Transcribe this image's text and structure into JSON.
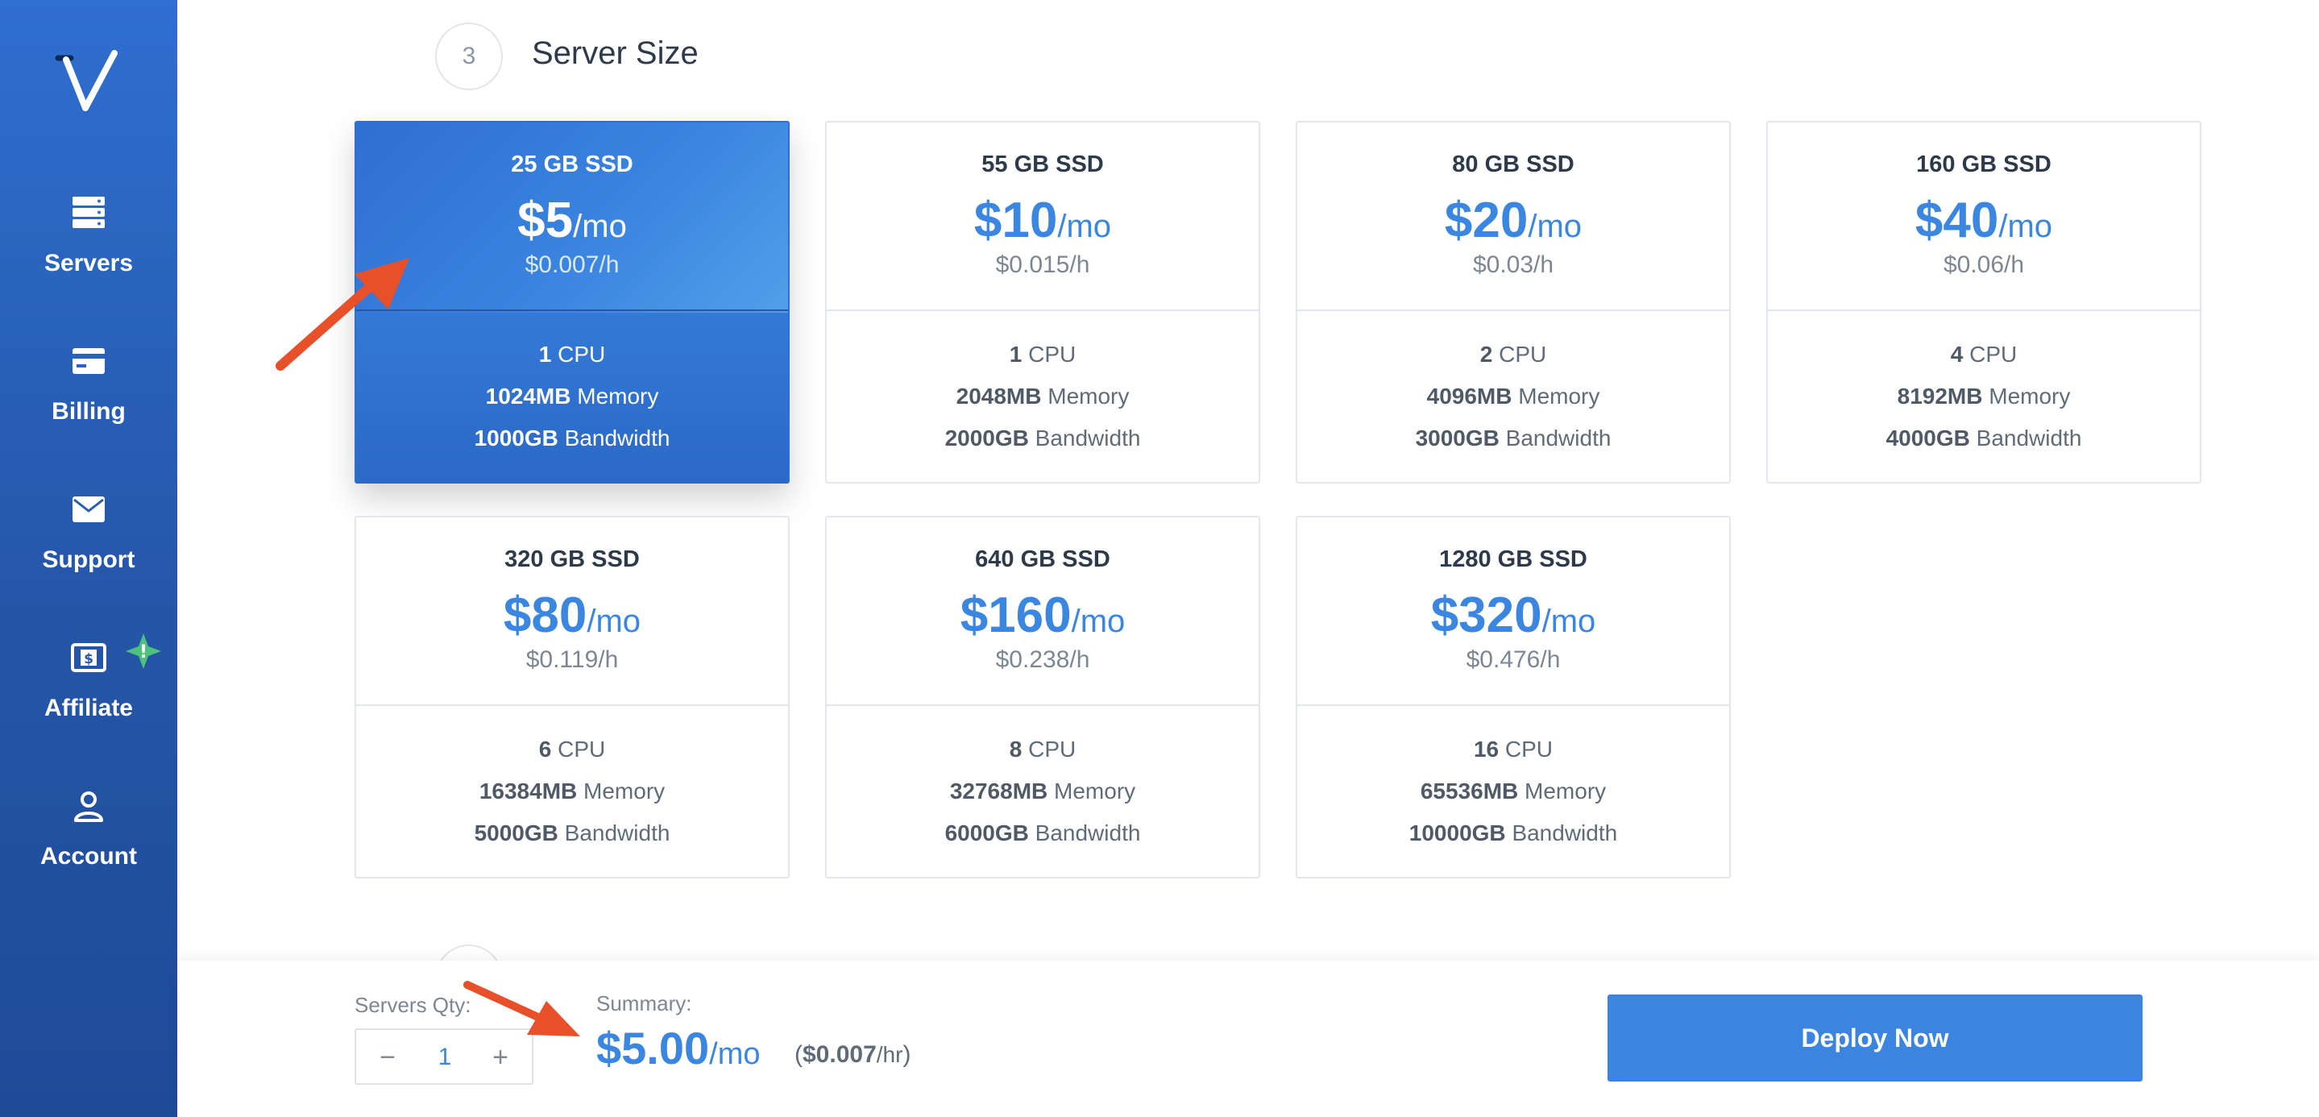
{
  "sidebar": {
    "items": [
      {
        "label": "Servers",
        "icon": "servers-icon"
      },
      {
        "label": "Billing",
        "icon": "credit-card-icon"
      },
      {
        "label": "Support",
        "icon": "envelope-icon"
      },
      {
        "label": "Affiliate",
        "icon": "dollar-bill-icon"
      },
      {
        "label": "Account",
        "icon": "user-icon"
      }
    ],
    "affiliate_badge": "!"
  },
  "step": {
    "number": "3",
    "title": "Server Size"
  },
  "plans": [
    {
      "ssd": "25 GB SSD",
      "price": "$5",
      "per": "/mo",
      "hourly": "$0.007/h",
      "cpu": "1",
      "cpu_label": "CPU",
      "memory": "1024MB",
      "memory_label": "Memory",
      "bandwidth": "1000GB",
      "bandwidth_label": "Bandwidth",
      "selected": true
    },
    {
      "ssd": "55 GB SSD",
      "price": "$10",
      "per": "/mo",
      "hourly": "$0.015/h",
      "cpu": "1",
      "cpu_label": "CPU",
      "memory": "2048MB",
      "memory_label": "Memory",
      "bandwidth": "2000GB",
      "bandwidth_label": "Bandwidth",
      "selected": false
    },
    {
      "ssd": "80 GB SSD",
      "price": "$20",
      "per": "/mo",
      "hourly": "$0.03/h",
      "cpu": "2",
      "cpu_label": "CPU",
      "memory": "4096MB",
      "memory_label": "Memory",
      "bandwidth": "3000GB",
      "bandwidth_label": "Bandwidth",
      "selected": false
    },
    {
      "ssd": "160 GB SSD",
      "price": "$40",
      "per": "/mo",
      "hourly": "$0.06/h",
      "cpu": "4",
      "cpu_label": "CPU",
      "memory": "8192MB",
      "memory_label": "Memory",
      "bandwidth": "4000GB",
      "bandwidth_label": "Bandwidth",
      "selected": false
    },
    {
      "ssd": "320 GB SSD",
      "price": "$80",
      "per": "/mo",
      "hourly": "$0.119/h",
      "cpu": "6",
      "cpu_label": "CPU",
      "memory": "16384MB",
      "memory_label": "Memory",
      "bandwidth": "5000GB",
      "bandwidth_label": "Bandwidth",
      "selected": false
    },
    {
      "ssd": "640 GB SSD",
      "price": "$160",
      "per": "/mo",
      "hourly": "$0.238/h",
      "cpu": "8",
      "cpu_label": "CPU",
      "memory": "32768MB",
      "memory_label": "Memory",
      "bandwidth": "6000GB",
      "bandwidth_label": "Bandwidth",
      "selected": false
    },
    {
      "ssd": "1280 GB SSD",
      "price": "$320",
      "per": "/mo",
      "hourly": "$0.476/h",
      "cpu": "16",
      "cpu_label": "CPU",
      "memory": "65536MB",
      "memory_label": "Memory",
      "bandwidth": "10000GB",
      "bandwidth_label": "Bandwidth",
      "selected": false
    }
  ],
  "footer": {
    "qty_label": "Servers Qty:",
    "qty_minus": "−",
    "qty_value": "1",
    "qty_plus": "+",
    "summary_label": "Summary:",
    "summary_price": "$5.00",
    "summary_per": "/mo",
    "summary_hourly_open": "(",
    "summary_hourly": "$0.007",
    "summary_hourly_unit": "/hr",
    "summary_hourly_close": ")",
    "deploy_label": "Deploy Now"
  },
  "colors": {
    "sidebar": "#2f6fd0",
    "accent": "#3b84e0",
    "annotation_arrow": "#e8502a",
    "badge": "#4cc27a"
  }
}
